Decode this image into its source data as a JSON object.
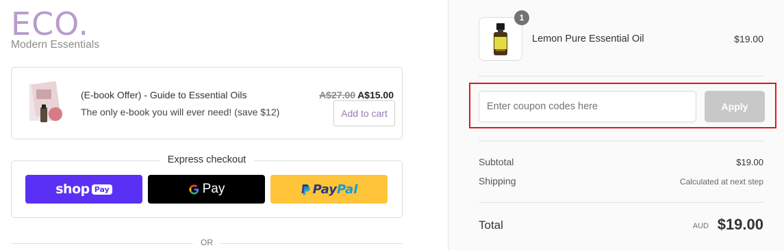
{
  "logo": {
    "main": "ECO.",
    "sub": "Modern Essentials"
  },
  "offer": {
    "title": "(E-book Offer) - Guide to Essential Oils",
    "description": "The only e-book you will ever need! (save $12)",
    "old_price": "A$27.00",
    "new_price": "A$15.00",
    "add_to_cart_label": "Add to cart"
  },
  "express": {
    "title": "Express checkout",
    "shop_pay": {
      "word": "shop",
      "badge": "Pay"
    },
    "google_pay": {
      "word": "Pay"
    },
    "paypal": {
      "part1": "Pay",
      "part2": "Pal"
    }
  },
  "divider_text": "OR",
  "cart": {
    "item": {
      "name": "Lemon Pure Essential Oil",
      "price": "$19.00",
      "quantity": "1"
    }
  },
  "coupon": {
    "placeholder": "Enter coupon codes here",
    "apply_label": "Apply"
  },
  "summary": {
    "subtotal_label": "Subtotal",
    "subtotal_value": "$19.00",
    "shipping_label": "Shipping",
    "shipping_value": "Calculated at next step",
    "total_label": "Total",
    "currency": "AUD",
    "total_value": "$19.00"
  },
  "colors": {
    "brand": "#b79ccc",
    "shop_pay": "#5a31f4",
    "paypal": "#ffc439",
    "highlight": "#e3131b"
  }
}
